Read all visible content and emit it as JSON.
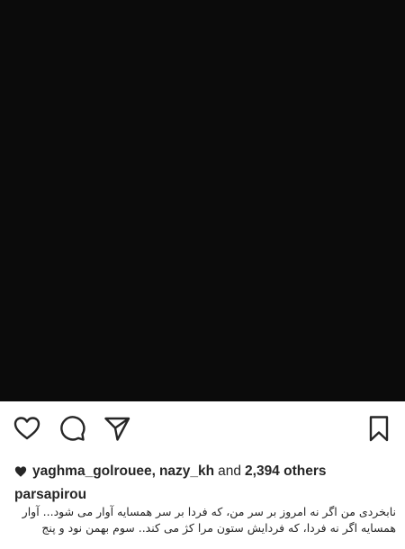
{
  "post": {
    "image": {
      "background_color": "#0b0b0b"
    },
    "actions": {
      "like_icon": "heart-outline-icon",
      "comment_icon": "comment-bubble-icon",
      "share_icon": "paper-plane-icon",
      "save_icon": "bookmark-icon"
    },
    "likes": {
      "icon": "heart-filled-icon",
      "user_1": "yaghma_golrouee",
      "separator": ",",
      "user_2": "nazy_kh",
      "and_text": "and",
      "others": "2,394 others"
    },
    "caption": {
      "username": "parsapirou",
      "text": "نابخردی من اگر نه امروز بر سر من، که فردا بر سر همسایه آوار می شود... آوار همسایه اگر نه فردا، که فردایش ستون مرا کژ می کند.. سوم بهمن نود و پنج"
    }
  }
}
